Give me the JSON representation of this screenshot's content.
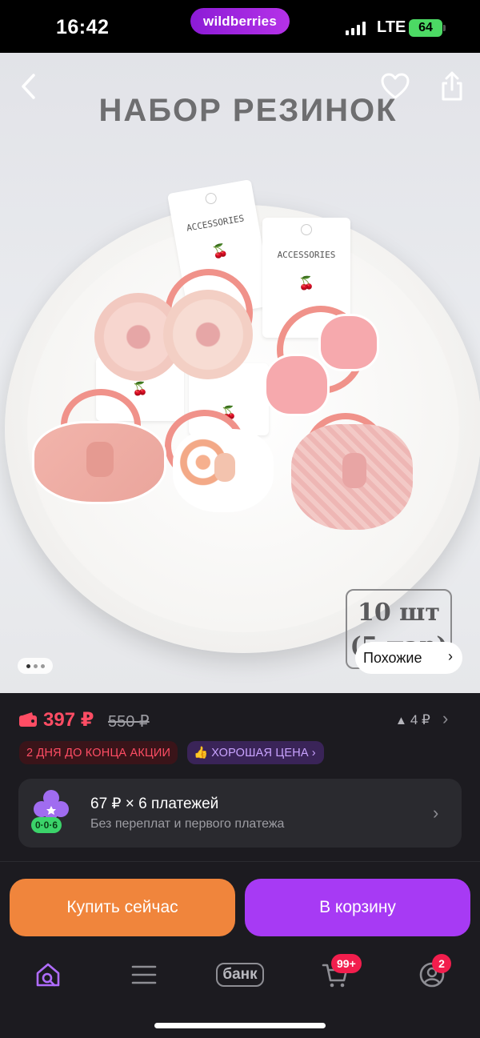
{
  "status_bar": {
    "time": "16:42",
    "brand": "wildberries",
    "network": "LTE",
    "battery": "64"
  },
  "product_image": {
    "headline": "НАБОР РЕЗИНОК",
    "card_label": "ACCESSORIES",
    "quantity_line1": "10 шт",
    "quantity_line2": "(5 пар)",
    "similar_label": "Похожие",
    "page_indicator": {
      "current": 1,
      "total": 3
    }
  },
  "price": {
    "current": "397 ₽",
    "old": "550 ₽",
    "cashback": "4 ₽",
    "accent_color": "#ff4d64"
  },
  "badges": {
    "sale": "2 ДНЯ ДО КОНЦА АКЦИИ",
    "good_price": "ХОРОШАЯ ЦЕНА"
  },
  "installment": {
    "title": "67 ₽ × 6 платежей",
    "subtitle": "Без переплат и первого платежа",
    "schedule_label": "0·0·6"
  },
  "actions": {
    "buy_now": "Купить сейчас",
    "add_to_cart": "В корзину",
    "buy_color": "#f0853c",
    "cart_color": "#a73af4"
  },
  "tabbar": {
    "bank_label": "банк",
    "cart_count": "99+",
    "profile_count": "2"
  }
}
